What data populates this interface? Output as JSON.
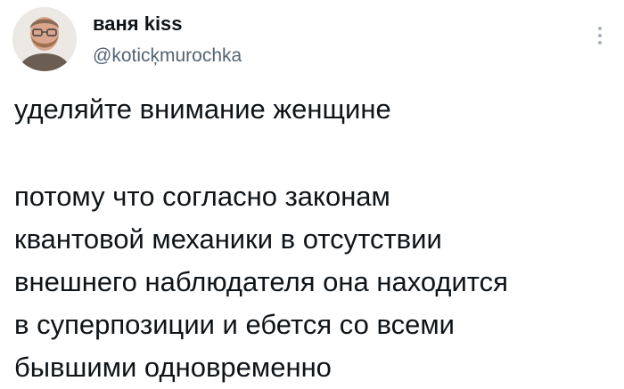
{
  "tweet": {
    "display_name": "ваня kiss",
    "handle": "@koticķmurochka",
    "avatar_icon": "user-avatar",
    "more_icon": "more-options-icon",
    "first_paragraph": "уделяйте внимание женщине",
    "second_paragraph_lines": [
      "потому что согласно законам",
      "квантовой механики в отсутствии",
      "внешнего наблюдателя она находится",
      "в суперпозиции и ебется со всеми",
      "бывшими одновременно"
    ]
  }
}
